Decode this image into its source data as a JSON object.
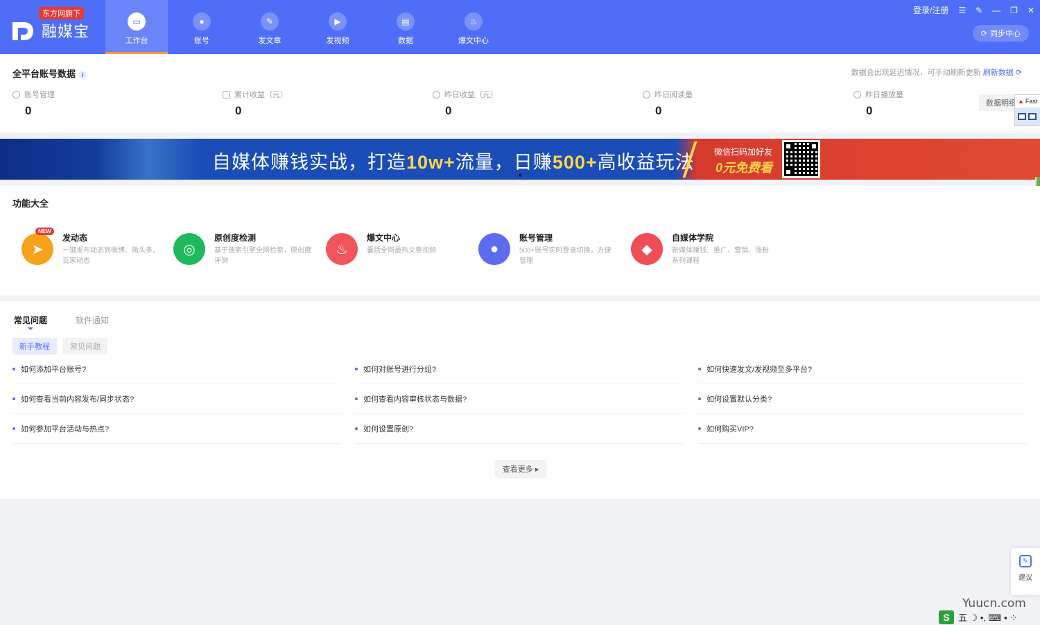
{
  "header": {
    "logo_tag": "东方网旗下",
    "logo_name": "融媒宝",
    "nav": [
      {
        "label": "工作台",
        "icon": "monitor-icon"
      },
      {
        "label": "账号",
        "icon": "user-icon"
      },
      {
        "label": "发文章",
        "icon": "feather-icon"
      },
      {
        "label": "发视频",
        "icon": "play-icon"
      },
      {
        "label": "数据",
        "icon": "chart-icon"
      },
      {
        "label": "爆文中心",
        "icon": "flame-icon"
      }
    ],
    "login": "登录/注册",
    "sync": "同步中心"
  },
  "stats": {
    "title": "全平台账号数据",
    "notice": "数据会出现延迟情况，可手动刷新更新",
    "refresh": "刷新数据",
    "items": [
      {
        "label": "账号管理",
        "value": "0"
      },
      {
        "label": "累计收益（元）",
        "value": "0"
      },
      {
        "label": "昨日收益（元）",
        "value": "0"
      },
      {
        "label": "昨日阅读量",
        "value": "0"
      },
      {
        "label": "昨日播放量",
        "value": "0"
      }
    ],
    "detail": "数据明细",
    "float_label": "Fast"
  },
  "banner": {
    "text_a": "自媒体赚钱实战，打造",
    "text_hl1": "10w+",
    "text_b": "流量，日赚",
    "text_hl2": "500+",
    "text_c": "高收益玩法",
    "wechat": "微信扫码加好友",
    "free": "0元免费看"
  },
  "features": {
    "title": "功能大全",
    "new_badge": "NEW",
    "items": [
      {
        "title": "发动态",
        "desc": "一键发布动态到微博、微头条、百家动态",
        "color": "#f7a21b",
        "icon": "paper-plane-icon"
      },
      {
        "title": "原创度检测",
        "desc": "基于搜索引擎全网检索，原创度评测",
        "color": "#1fb85d",
        "icon": "radar-icon"
      },
      {
        "title": "爆文中心",
        "desc": "囊括全网最热文章视频",
        "color": "#f2545b",
        "icon": "flame-icon"
      },
      {
        "title": "账号管理",
        "desc": "500+账号实时登录切换，方便管理",
        "color": "#5b6cf0",
        "icon": "user-icon"
      },
      {
        "title": "自媒体学院",
        "desc": "新媒体赚钱、推广、营销、涨粉系列课程",
        "color": "#ef4d57",
        "icon": "graduation-cap-icon"
      }
    ]
  },
  "faq": {
    "tab_active": "常见问题",
    "tab_inactive": "软件通知",
    "sub_active": "新手教程",
    "sub_inactive": "常见问题",
    "items": [
      "如何添加平台账号?",
      "如何对账号进行分组?",
      "如何快速发文/发视频至多平台?",
      "如何查看当前内容发布/同步状态?",
      "如何查看内容审核状态与数据?",
      "如何设置默认分类?",
      "如何参加平台活动与热点?",
      "如何设置原创?",
      "如何购买VIP?"
    ],
    "more": "查看更多 ▸"
  },
  "side": {
    "suggest": "建议"
  },
  "footer": {
    "watermark": "Yuucn.com",
    "ime_s": "S",
    "ime_text": "五 ☽ •, ⌨ ▪ ⁘"
  }
}
